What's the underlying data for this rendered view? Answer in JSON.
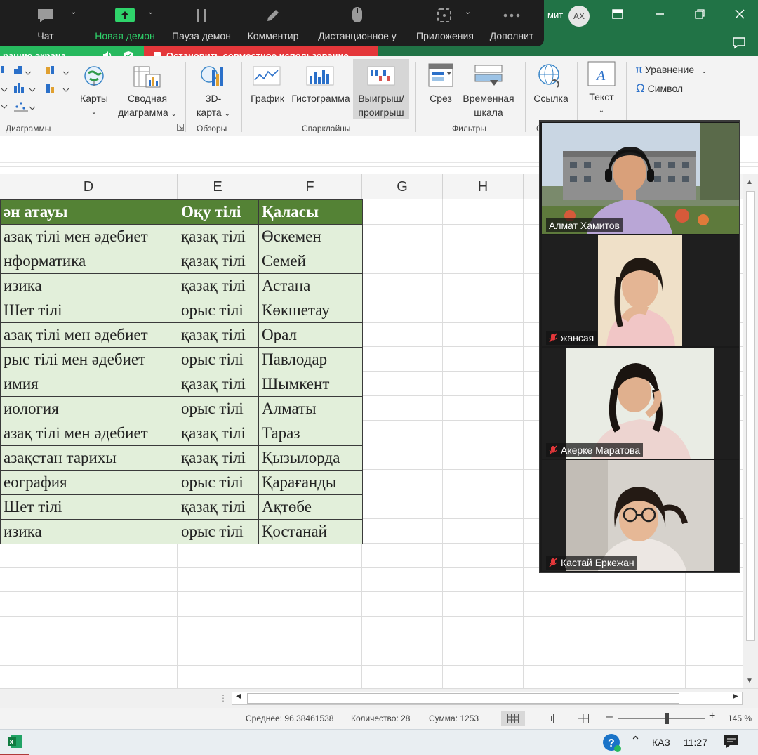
{
  "titlebar": {
    "title_fragment": "мит",
    "avatar_initials": "АХ"
  },
  "zoom_toolbar": {
    "chat": "Чат",
    "new_demo": "Новая демон",
    "pause_demo": "Пауза демон",
    "comment": "Комментир",
    "remote": "Дистанционное у",
    "apps": "Приложения",
    "more": "Дополнит"
  },
  "sharing": {
    "screen_label": "рацию экрана",
    "stop_label": "Остановить совместное использование"
  },
  "ribbon": {
    "maps": "Карты",
    "pivot_chart_1": "Сводная",
    "pivot_chart_2": "диаграмма",
    "map3d_1": "3D-",
    "map3d_2": "карта",
    "sparkline_line": "График",
    "sparkline_column": "Гистограмма",
    "winloss_1": "Выигрыш/",
    "winloss_2": "проигрыш",
    "slicer": "Срез",
    "timeline_1": "Временная",
    "timeline_2": "шкала",
    "link": "Ссылка",
    "text": "Текст",
    "equation": "Уравнение",
    "symbol": "Символ",
    "group_charts": "Диаграммы",
    "group_tours": "Обзоры",
    "group_sparklines": "Спарклайны",
    "group_filters": "Фильтры",
    "group_links": "С"
  },
  "columns": [
    "D",
    "E",
    "F",
    "G",
    "H"
  ],
  "table": {
    "headers": [
      "ән атауы",
      "Оқу тілі",
      "Қаласы"
    ],
    "rows": [
      [
        "азақ тілі мен әдебиет",
        "қазақ тілі",
        "Өскемен"
      ],
      [
        "нформатика",
        "қазақ тілі",
        "Семей"
      ],
      [
        "изика",
        "қазақ тілі",
        "Астана"
      ],
      [
        "Шет тілі",
        "орыс тілі",
        "Көкшетау"
      ],
      [
        "азақ тілі мен әдебиет",
        "қазақ тілі",
        "Орал"
      ],
      [
        "рыс тілі мен әдебиет",
        "орыс тілі",
        "Павлодар"
      ],
      [
        "имия",
        "қазақ тілі",
        "Шымкент"
      ],
      [
        "иология",
        "орыс тілі",
        "Алматы"
      ],
      [
        "азақ тілі мен әдебиет",
        "қазақ тілі",
        "Тараз"
      ],
      [
        "азақстан тарихы",
        "қазақ тілі",
        "Қызылорда"
      ],
      [
        "еография",
        "орыс тілі",
        "Қарағанды"
      ],
      [
        "Шет тілі",
        "қазақ тілі",
        "Ақтөбе"
      ],
      [
        "изика",
        "орыс тілі",
        "Қостанай"
      ]
    ]
  },
  "statusbar": {
    "average": "Среднее: 96,38461538",
    "count": "Количество: 28",
    "sum": "Сумма: 1253",
    "zoom": "145 %"
  },
  "taskbar": {
    "lang": "КАЗ",
    "time": "11:27"
  },
  "participants": [
    {
      "name": "Алмат Хамитов",
      "muted": false
    },
    {
      "name": "жансая",
      "muted": true
    },
    {
      "name": "Акерке Маратова",
      "muted": true
    },
    {
      "name": "Қастай Еркежан",
      "muted": true
    }
  ],
  "colors": {
    "excel_green": "#217346",
    "header_fill": "#548235",
    "cell_fill": "#e2efda",
    "zoom_active": "#2fd46b",
    "stop_red": "#e4373a"
  }
}
